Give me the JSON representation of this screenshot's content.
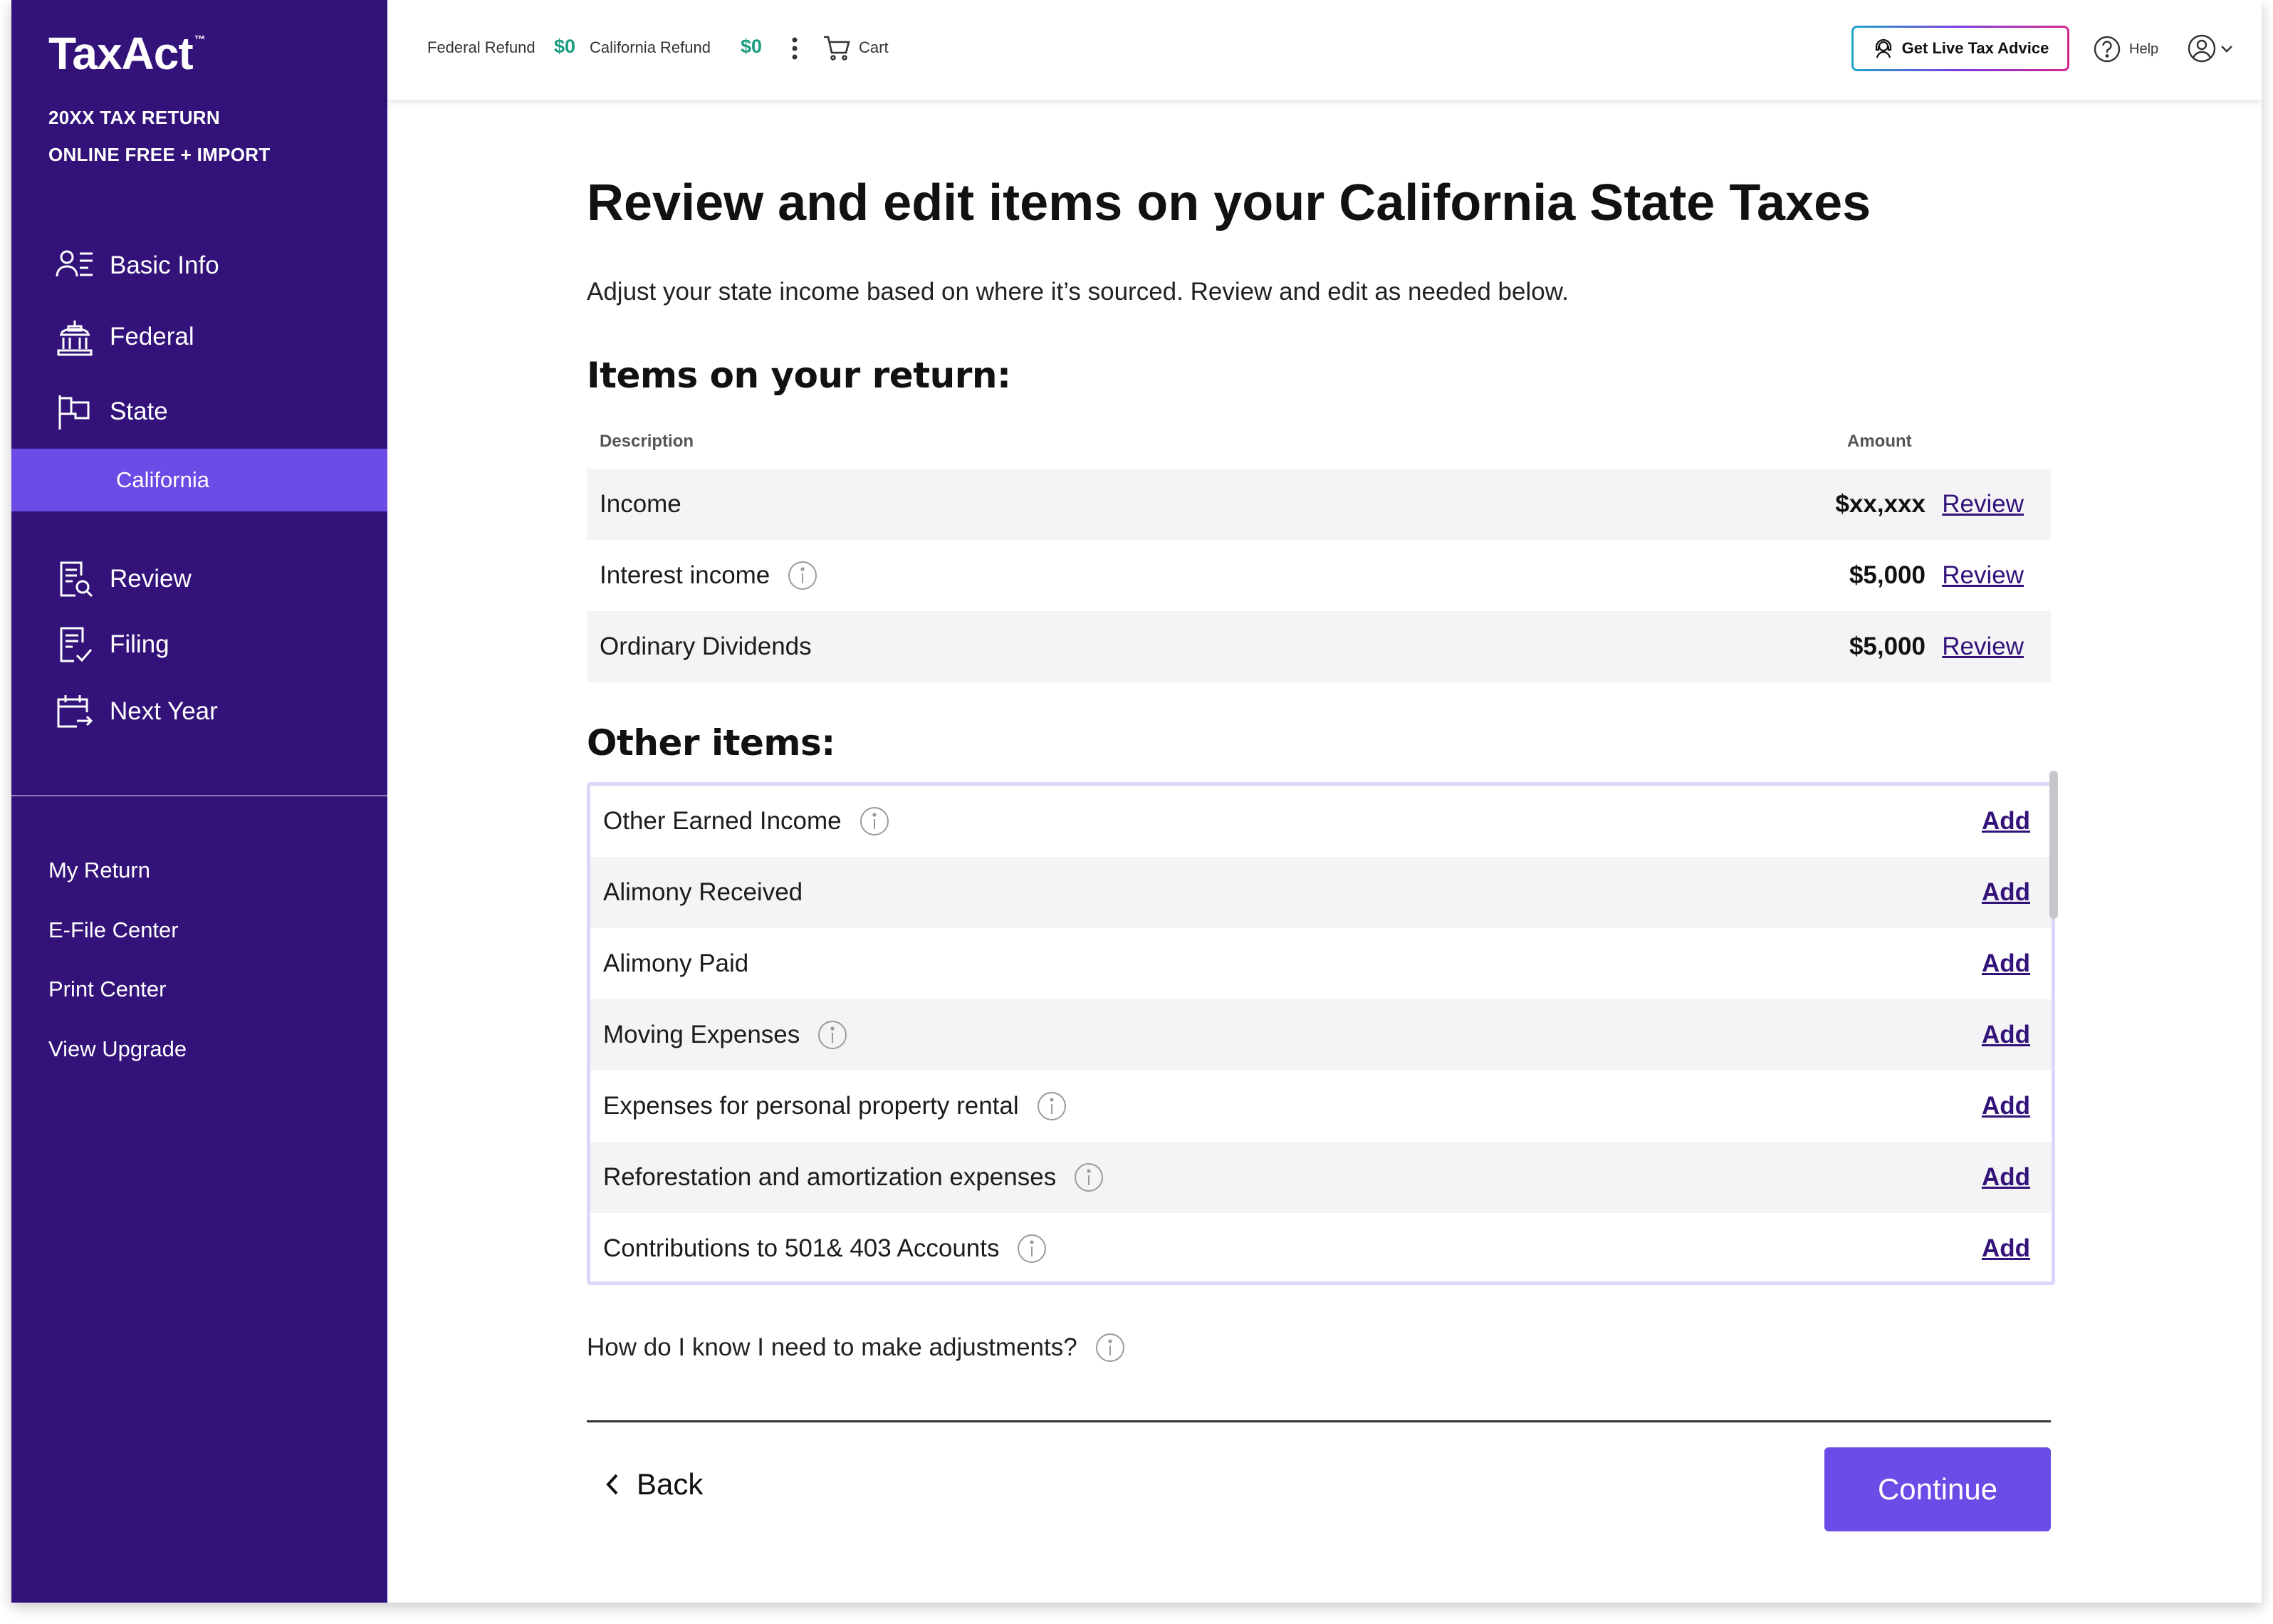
{
  "brand": {
    "name": "TaxAct",
    "return_line1": "20XX TAX RETURN",
    "return_line2": "ONLINE FREE + IMPORT"
  },
  "sidebar": {
    "items": [
      {
        "label": "Basic Info",
        "icon": "user-list-icon"
      },
      {
        "label": "Federal",
        "icon": "government-building-icon"
      },
      {
        "label": "State",
        "icon": "flag-icon"
      },
      {
        "label": "Review",
        "icon": "document-search-icon"
      },
      {
        "label": "Filing",
        "icon": "document-check-icon"
      },
      {
        "label": "Next Year",
        "icon": "calendar-arrow-icon"
      }
    ],
    "active_sub": "California",
    "links": [
      "My Return",
      "E-File Center",
      "Print Center",
      "View Upgrade"
    ]
  },
  "topbar": {
    "federal_label": "Federal Refund",
    "federal_amount": "$0",
    "state_label": "California Refund",
    "state_amount": "$0",
    "cart_label": "Cart",
    "advice_label": "Get Live Tax Advice",
    "help_label": "Help"
  },
  "page": {
    "title": "Review and edit items on your California State Taxes",
    "subtitle": "Adjust your state income based on where it’s sourced. Review and edit as needed below.",
    "items_heading": "Items on your return:",
    "col_description": "Description",
    "col_amount": "Amount",
    "items": [
      {
        "label": "Income",
        "amount": "$xx,xxx",
        "action": "Review",
        "info": false
      },
      {
        "label": "Interest income",
        "amount": "$5,000",
        "action": "Review",
        "info": true
      },
      {
        "label": "Ordinary Dividends",
        "amount": "$5,000",
        "action": "Review",
        "info": false
      }
    ],
    "other_heading": "Other items:",
    "other_items": [
      {
        "label": "Other Earned Income",
        "action": "Add",
        "info": true
      },
      {
        "label": "Alimony Received",
        "action": "Add",
        "info": false
      },
      {
        "label": "Alimony Paid",
        "action": "Add",
        "info": false
      },
      {
        "label": "Moving Expenses",
        "action": "Add",
        "info": true
      },
      {
        "label": "Expenses for personal property rental",
        "action": "Add",
        "info": true
      },
      {
        "label": "Reforestation and amortization expenses",
        "action": "Add",
        "info": true
      },
      {
        "label": "Contributions to 501& 403 Accounts",
        "action": "Add",
        "info": true
      }
    ],
    "help_question": "How do I know I need to make adjustments?",
    "back_label": "Back",
    "continue_label": "Continue"
  },
  "colors": {
    "sidebar": "#33137a",
    "accent": "#6b4ce6",
    "refund": "#1a9c7e",
    "link": "#33137a"
  }
}
